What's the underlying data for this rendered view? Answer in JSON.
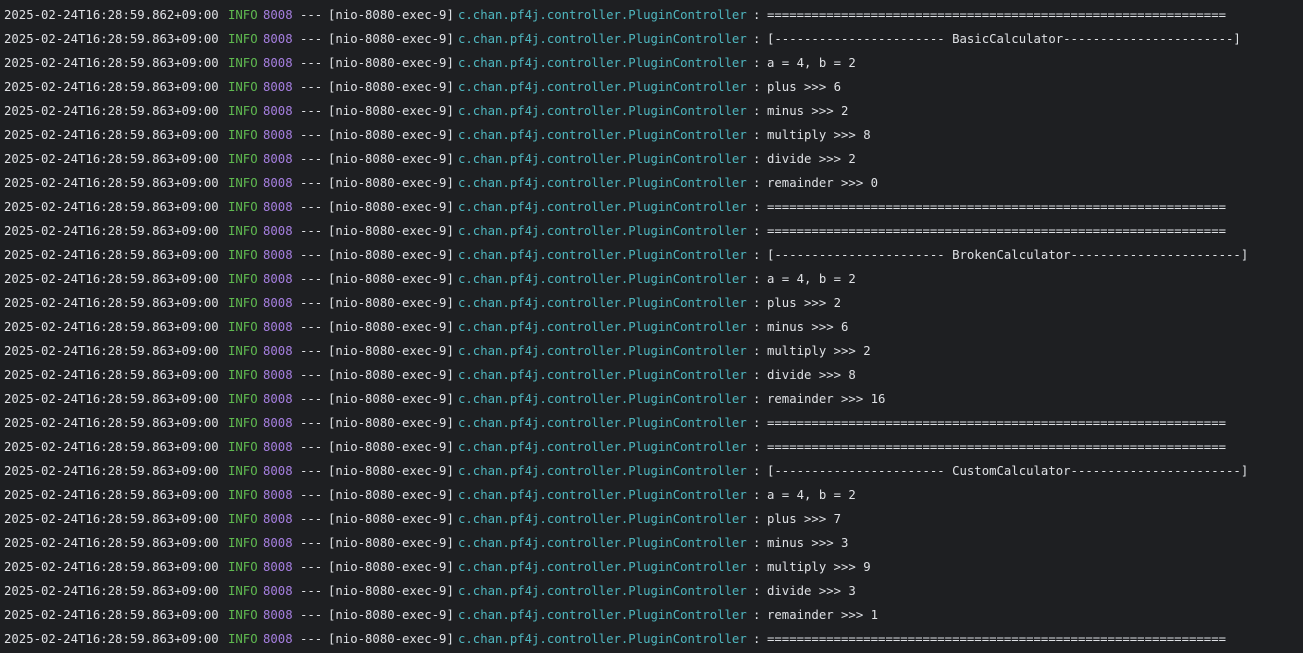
{
  "console": {
    "lines": [
      {
        "timestamp": "2025-02-24T16:28:59.862+09:00",
        "level": "INFO",
        "pid": "8008",
        "separator": "---",
        "thread": "[nio-8080-exec-9]",
        "logger": "c.chan.pf4j.controller.PluginController",
        "colon": ":",
        "message": "=============================================================="
      },
      {
        "timestamp": "2025-02-24T16:28:59.863+09:00",
        "level": "INFO",
        "pid": "8008",
        "separator": "---",
        "thread": "[nio-8080-exec-9]",
        "logger": "c.chan.pf4j.controller.PluginController",
        "colon": ":",
        "message": "[----------------------- BasicCalculator-----------------------]"
      },
      {
        "timestamp": "2025-02-24T16:28:59.863+09:00",
        "level": "INFO",
        "pid": "8008",
        "separator": "---",
        "thread": "[nio-8080-exec-9]",
        "logger": "c.chan.pf4j.controller.PluginController",
        "colon": ":",
        "message": "a = 4, b = 2"
      },
      {
        "timestamp": "2025-02-24T16:28:59.863+09:00",
        "level": "INFO",
        "pid": "8008",
        "separator": "---",
        "thread": "[nio-8080-exec-9]",
        "logger": "c.chan.pf4j.controller.PluginController",
        "colon": ":",
        "message": "plus >>> 6"
      },
      {
        "timestamp": "2025-02-24T16:28:59.863+09:00",
        "level": "INFO",
        "pid": "8008",
        "separator": "---",
        "thread": "[nio-8080-exec-9]",
        "logger": "c.chan.pf4j.controller.PluginController",
        "colon": ":",
        "message": "minus >>> 2"
      },
      {
        "timestamp": "2025-02-24T16:28:59.863+09:00",
        "level": "INFO",
        "pid": "8008",
        "separator": "---",
        "thread": "[nio-8080-exec-9]",
        "logger": "c.chan.pf4j.controller.PluginController",
        "colon": ":",
        "message": "multiply >>> 8"
      },
      {
        "timestamp": "2025-02-24T16:28:59.863+09:00",
        "level": "INFO",
        "pid": "8008",
        "separator": "---",
        "thread": "[nio-8080-exec-9]",
        "logger": "c.chan.pf4j.controller.PluginController",
        "colon": ":",
        "message": "divide >>> 2"
      },
      {
        "timestamp": "2025-02-24T16:28:59.863+09:00",
        "level": "INFO",
        "pid": "8008",
        "separator": "---",
        "thread": "[nio-8080-exec-9]",
        "logger": "c.chan.pf4j.controller.PluginController",
        "colon": ":",
        "message": "remainder >>> 0"
      },
      {
        "timestamp": "2025-02-24T16:28:59.863+09:00",
        "level": "INFO",
        "pid": "8008",
        "separator": "---",
        "thread": "[nio-8080-exec-9]",
        "logger": "c.chan.pf4j.controller.PluginController",
        "colon": ":",
        "message": "=============================================================="
      },
      {
        "timestamp": "2025-02-24T16:28:59.863+09:00",
        "level": "INFO",
        "pid": "8008",
        "separator": "---",
        "thread": "[nio-8080-exec-9]",
        "logger": "c.chan.pf4j.controller.PluginController",
        "colon": ":",
        "message": "=============================================================="
      },
      {
        "timestamp": "2025-02-24T16:28:59.863+09:00",
        "level": "INFO",
        "pid": "8008",
        "separator": "---",
        "thread": "[nio-8080-exec-9]",
        "logger": "c.chan.pf4j.controller.PluginController",
        "colon": ":",
        "message": "[----------------------- BrokenCalculator-----------------------]"
      },
      {
        "timestamp": "2025-02-24T16:28:59.863+09:00",
        "level": "INFO",
        "pid": "8008",
        "separator": "---",
        "thread": "[nio-8080-exec-9]",
        "logger": "c.chan.pf4j.controller.PluginController",
        "colon": ":",
        "message": "a = 4, b = 2"
      },
      {
        "timestamp": "2025-02-24T16:28:59.863+09:00",
        "level": "INFO",
        "pid": "8008",
        "separator": "---",
        "thread": "[nio-8080-exec-9]",
        "logger": "c.chan.pf4j.controller.PluginController",
        "colon": ":",
        "message": "plus >>> 2"
      },
      {
        "timestamp": "2025-02-24T16:28:59.863+09:00",
        "level": "INFO",
        "pid": "8008",
        "separator": "---",
        "thread": "[nio-8080-exec-9]",
        "logger": "c.chan.pf4j.controller.PluginController",
        "colon": ":",
        "message": "minus >>> 6"
      },
      {
        "timestamp": "2025-02-24T16:28:59.863+09:00",
        "level": "INFO",
        "pid": "8008",
        "separator": "---",
        "thread": "[nio-8080-exec-9]",
        "logger": "c.chan.pf4j.controller.PluginController",
        "colon": ":",
        "message": "multiply >>> 2"
      },
      {
        "timestamp": "2025-02-24T16:28:59.863+09:00",
        "level": "INFO",
        "pid": "8008",
        "separator": "---",
        "thread": "[nio-8080-exec-9]",
        "logger": "c.chan.pf4j.controller.PluginController",
        "colon": ":",
        "message": "divide >>> 8"
      },
      {
        "timestamp": "2025-02-24T16:28:59.863+09:00",
        "level": "INFO",
        "pid": "8008",
        "separator": "---",
        "thread": "[nio-8080-exec-9]",
        "logger": "c.chan.pf4j.controller.PluginController",
        "colon": ":",
        "message": "remainder >>> 16"
      },
      {
        "timestamp": "2025-02-24T16:28:59.863+09:00",
        "level": "INFO",
        "pid": "8008",
        "separator": "---",
        "thread": "[nio-8080-exec-9]",
        "logger": "c.chan.pf4j.controller.PluginController",
        "colon": ":",
        "message": "=============================================================="
      },
      {
        "timestamp": "2025-02-24T16:28:59.863+09:00",
        "level": "INFO",
        "pid": "8008",
        "separator": "---",
        "thread": "[nio-8080-exec-9]",
        "logger": "c.chan.pf4j.controller.PluginController",
        "colon": ":",
        "message": "=============================================================="
      },
      {
        "timestamp": "2025-02-24T16:28:59.863+09:00",
        "level": "INFO",
        "pid": "8008",
        "separator": "---",
        "thread": "[nio-8080-exec-9]",
        "logger": "c.chan.pf4j.controller.PluginController",
        "colon": ":",
        "message": "[----------------------- CustomCalculator-----------------------]"
      },
      {
        "timestamp": "2025-02-24T16:28:59.863+09:00",
        "level": "INFO",
        "pid": "8008",
        "separator": "---",
        "thread": "[nio-8080-exec-9]",
        "logger": "c.chan.pf4j.controller.PluginController",
        "colon": ":",
        "message": "a = 4, b = 2"
      },
      {
        "timestamp": "2025-02-24T16:28:59.863+09:00",
        "level": "INFO",
        "pid": "8008",
        "separator": "---",
        "thread": "[nio-8080-exec-9]",
        "logger": "c.chan.pf4j.controller.PluginController",
        "colon": ":",
        "message": "plus >>> 7"
      },
      {
        "timestamp": "2025-02-24T16:28:59.863+09:00",
        "level": "INFO",
        "pid": "8008",
        "separator": "---",
        "thread": "[nio-8080-exec-9]",
        "logger": "c.chan.pf4j.controller.PluginController",
        "colon": ":",
        "message": "minus >>> 3"
      },
      {
        "timestamp": "2025-02-24T16:28:59.863+09:00",
        "level": "INFO",
        "pid": "8008",
        "separator": "---",
        "thread": "[nio-8080-exec-9]",
        "logger": "c.chan.pf4j.controller.PluginController",
        "colon": ":",
        "message": "multiply >>> 9"
      },
      {
        "timestamp": "2025-02-24T16:28:59.863+09:00",
        "level": "INFO",
        "pid": "8008",
        "separator": "---",
        "thread": "[nio-8080-exec-9]",
        "logger": "c.chan.pf4j.controller.PluginController",
        "colon": ":",
        "message": "divide >>> 3"
      },
      {
        "timestamp": "2025-02-24T16:28:59.863+09:00",
        "level": "INFO",
        "pid": "8008",
        "separator": "---",
        "thread": "[nio-8080-exec-9]",
        "logger": "c.chan.pf4j.controller.PluginController",
        "colon": ":",
        "message": "remainder >>> 1"
      },
      {
        "timestamp": "2025-02-24T16:28:59.863+09:00",
        "level": "INFO",
        "pid": "8008",
        "separator": "---",
        "thread": "[nio-8080-exec-9]",
        "logger": "c.chan.pf4j.controller.PluginController",
        "colon": ":",
        "message": "=============================================================="
      }
    ]
  },
  "colors": {
    "background": "#1e1f22",
    "text": "#dfe1e5",
    "level_info": "#5fb950",
    "pid": "#a67fe0",
    "logger": "#4fb7c0"
  }
}
